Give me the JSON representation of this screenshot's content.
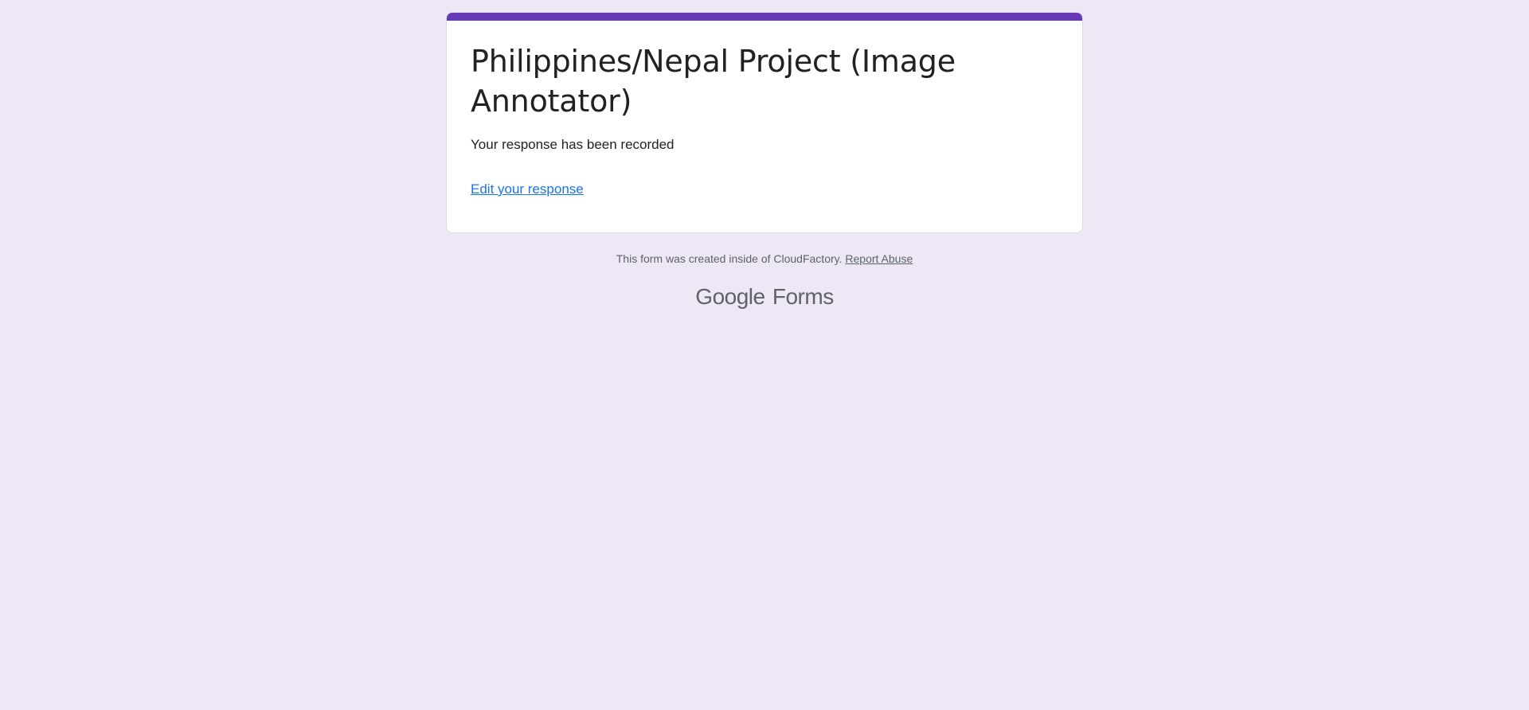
{
  "form": {
    "title": "Philippines/Nepal Project (Image Annotator)",
    "message": "Your response has been recorded",
    "edit_link": "Edit your response"
  },
  "footer": {
    "created_text": "This form was created inside of CloudFactory.",
    "report_link": "Report Abuse"
  },
  "brand": {
    "google": "Google",
    "product": "Forms"
  },
  "colors": {
    "background": "#ede7f6",
    "accent": "#673ab7",
    "link": "#1a73e8",
    "text": "#202124",
    "muted_text": "#5f6368"
  }
}
